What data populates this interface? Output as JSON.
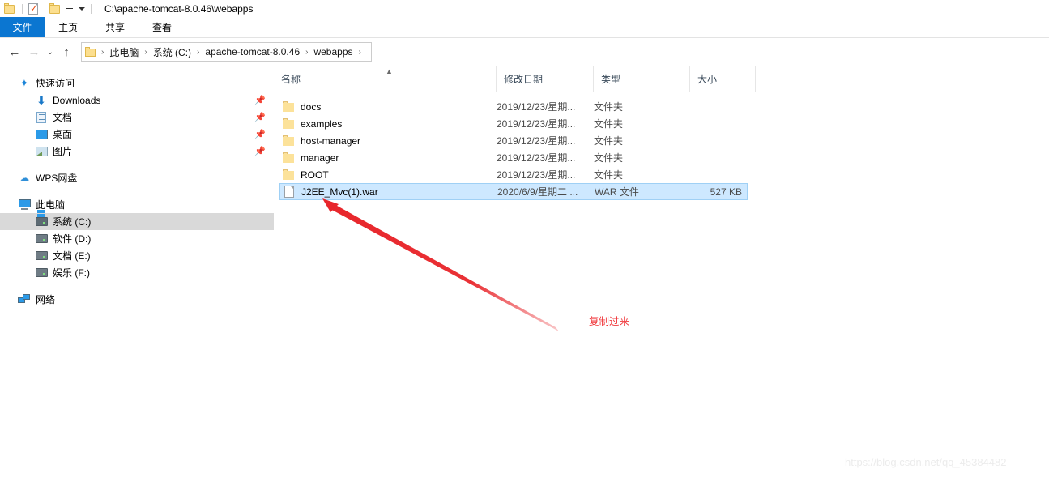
{
  "window": {
    "title": "C:\\apache-tomcat-8.0.46\\webapps",
    "quick_access": {
      "folder_icon": "folder-icon",
      "properties_icon": "properties-icon",
      "new_folder_icon": "new-folder-icon",
      "customize_icon": "chevron-down-icon"
    }
  },
  "ribbon": {
    "tabs": [
      {
        "label": "文件",
        "active": true
      },
      {
        "label": "主页",
        "active": false
      },
      {
        "label": "共享",
        "active": false
      },
      {
        "label": "查看",
        "active": false
      }
    ],
    "accent_color": "#0b76d1"
  },
  "address_bar": {
    "back_icon": "back-arrow-icon",
    "forward_icon": "forward-arrow-icon",
    "recent_icon": "chevron-down-icon",
    "up_icon": "up-arrow-icon",
    "breadcrumb": [
      "此电脑",
      "系统 (C:)",
      "apache-tomcat-8.0.46",
      "webapps"
    ],
    "separator": "›"
  },
  "sidebar": {
    "items": [
      {
        "label": "快速访问",
        "icon": "star-icon",
        "indent": 0,
        "pinned": false,
        "selected": false
      },
      {
        "label": "Downloads",
        "icon": "download-icon",
        "indent": 1,
        "pinned": true,
        "selected": false
      },
      {
        "label": "文档",
        "icon": "documents-icon",
        "indent": 1,
        "pinned": true,
        "selected": false
      },
      {
        "label": "桌面",
        "icon": "desktop-icon",
        "indent": 1,
        "pinned": true,
        "selected": false
      },
      {
        "label": "图片",
        "icon": "pictures-icon",
        "indent": 1,
        "pinned": true,
        "selected": false
      },
      {
        "label": "WPS网盘",
        "icon": "cloud-icon",
        "indent": 0,
        "pinned": false,
        "selected": false
      },
      {
        "label": "此电脑",
        "icon": "this-pc-icon",
        "indent": 0,
        "pinned": false,
        "selected": false
      },
      {
        "label": "系统 (C:)",
        "icon": "system-drive-icon",
        "indent": 1,
        "pinned": false,
        "selected": true
      },
      {
        "label": "软件 (D:)",
        "icon": "drive-icon",
        "indent": 1,
        "pinned": false,
        "selected": false
      },
      {
        "label": "文档 (E:)",
        "icon": "drive-icon",
        "indent": 1,
        "pinned": false,
        "selected": false
      },
      {
        "label": "娱乐 (F:)",
        "icon": "drive-icon",
        "indent": 1,
        "pinned": false,
        "selected": false
      },
      {
        "label": "网络",
        "icon": "network-icon",
        "indent": 0,
        "pinned": false,
        "selected": false
      }
    ],
    "pin_glyph": "📌",
    "selected_bg": "#d9d9d9"
  },
  "file_list": {
    "columns": [
      {
        "label": "名称",
        "key": "name"
      },
      {
        "label": "修改日期",
        "key": "date"
      },
      {
        "label": "类型",
        "key": "type"
      },
      {
        "label": "大小",
        "key": "size"
      }
    ],
    "sort_column": "名称",
    "sort_direction": "ascending",
    "rows": [
      {
        "name": "docs",
        "date": "2019/12/23/星期...",
        "type": "文件夹",
        "size": "",
        "icon": "folder-icon",
        "selected": false
      },
      {
        "name": "examples",
        "date": "2019/12/23/星期...",
        "type": "文件夹",
        "size": "",
        "icon": "folder-icon",
        "selected": false
      },
      {
        "name": "host-manager",
        "date": "2019/12/23/星期...",
        "type": "文件夹",
        "size": "",
        "icon": "folder-icon",
        "selected": false
      },
      {
        "name": "manager",
        "date": "2019/12/23/星期...",
        "type": "文件夹",
        "size": "",
        "icon": "folder-icon",
        "selected": false
      },
      {
        "name": "ROOT",
        "date": "2019/12/23/星期...",
        "type": "文件夹",
        "size": "",
        "icon": "folder-icon",
        "selected": false
      },
      {
        "name": "J2EE_Mvc(1).war",
        "date": "2020/6/9/星期二 ...",
        "type": "WAR 文件",
        "size": "527 KB",
        "icon": "file-icon",
        "selected": true
      }
    ],
    "selection_color": "#cde8ff"
  },
  "annotation": {
    "text": "复制过来",
    "color": "#f0383c",
    "arrow": "red-arrow-pointing-to-selected-file"
  },
  "watermark": {
    "text": "https://blog.csdn.net/qq_45384482"
  }
}
